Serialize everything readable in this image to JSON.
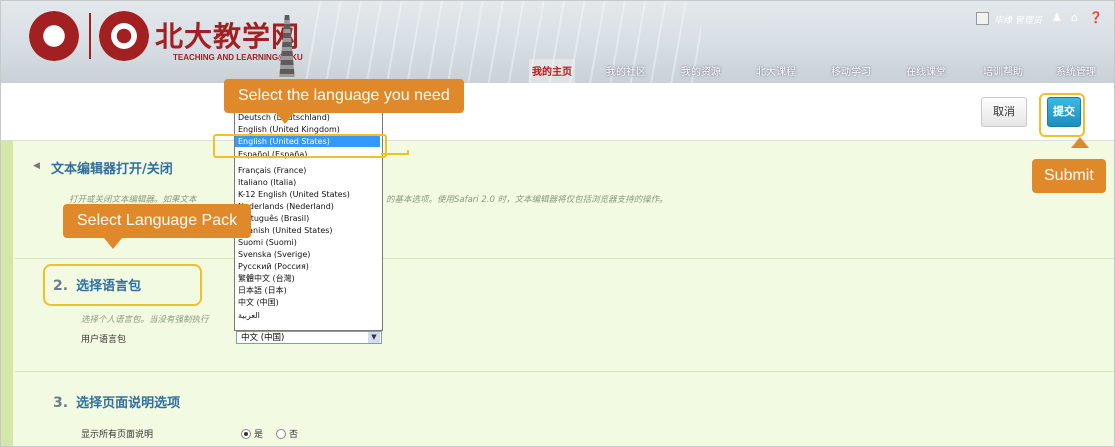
{
  "header": {
    "logo_text": "北大教学网",
    "logo_sub": "TEACHING AND LEARNING@PKU",
    "nav": [
      "我的主页",
      "我的社区",
      "我的资源",
      "北大课程",
      "移动学习",
      "在线课堂",
      "培训帮助",
      "系统管理"
    ],
    "active_nav": "我的主页",
    "user_name": "毕缘 管理员"
  },
  "toolbar": {
    "cancel_label": "取消",
    "submit_label": "提交"
  },
  "callouts": {
    "language": "Select the language you need",
    "pack": "Select Language Pack",
    "submit": "Submit"
  },
  "sections": {
    "s1_title": "文本编辑器打开/关闭",
    "s1_desc_left": "打开或关闭文本编辑器。如果文本",
    "s1_desc_right": "的基本选项。使用Safari 2.0 时，文本编辑器将仅包括浏览器支持的操作。",
    "s2_num": "2.",
    "s2_title": "选择语言包",
    "s2_desc": "选择个人语言包。当没有强制执行",
    "s2_label": "用户语言包",
    "s2_selected": "中文 (中国)",
    "s3_num": "3.",
    "s3_title": "选择页面说明选项",
    "s3_label": "显示所有页面说明",
    "s3_yes": "是",
    "s3_no": "否"
  },
  "language_options": [
    "Deutsch (Deutschland)",
    "English (United Kingdom)",
    "English (United States)",
    "Español (España)",
    "Français (France)",
    "Italiano (Italia)",
    "K-12 English (United States)",
    "Nederlands (Nederland)",
    "Português (Brasil)",
    "Spanish (United States)",
    "Suomi (Suomi)",
    "Svenska (Sverige)",
    "Русский (Россия)",
    "繁體中文 (台灣)",
    "日本語 (日本)",
    "中文 (中国)",
    "العربية"
  ],
  "selected_language": "English (United States)",
  "colors": {
    "accent": "#e0892b",
    "highlight": "#f0c02a",
    "submit": "#1a8fbf",
    "selection": "#3399ff"
  }
}
